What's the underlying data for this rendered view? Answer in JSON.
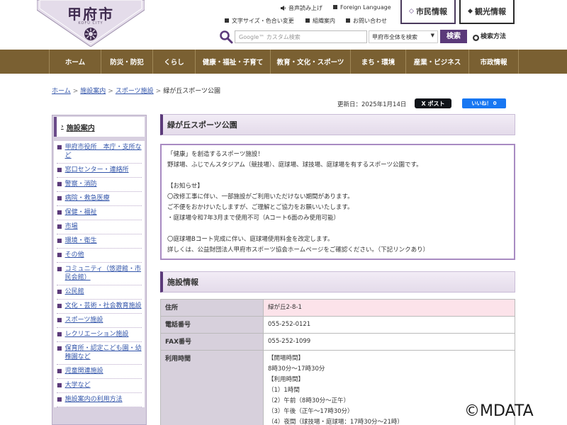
{
  "header": {
    "logo_title": "甲府市",
    "logo_sub": "KOFU CITY",
    "links": {
      "audio": "音声読み上げ",
      "foreign": "Foreign Language",
      "font_color": "文字サイズ・色合い変更",
      "org": "組織案内",
      "contact": "お問い合わせ"
    },
    "tab_shimin": "市民情報",
    "tab_kanko": "観光情報",
    "search_placeholder": "Google™ カスタム検索",
    "search_scope": "甲府市全体を検索",
    "search_button": "検索",
    "search_help": "検索方法"
  },
  "gnav": {
    "items": [
      "ホーム",
      "防災・防犯",
      "くらし",
      "健康・福祉・子育て",
      "教育・文化・スポーツ",
      "まち・環境",
      "産業・ビジネス",
      "市政情報"
    ]
  },
  "breadcrumb": {
    "home": "ホーム",
    "facility": "施設案内",
    "sports": "スポーツ施設",
    "current": "緑が丘スポーツ公園",
    "sep": ">"
  },
  "meta": {
    "updated": "更新日：2025年1月14日",
    "x_post": "X ポスト",
    "fb_like": "いいね！ 0"
  },
  "sidebar": {
    "title": "施設案内",
    "items": [
      "甲府市役所　本庁・支所など",
      "窓口センター・連絡所",
      "警察・消防",
      "病院・救急医療",
      "保健・福祉",
      "市場",
      "環境・衛生",
      "その他",
      "コミュニティ（悠遊館・市民会館）",
      "公民館",
      "文化・芸術・社会教育施設",
      "スポーツ施設",
      "レクリエーション施設",
      "保育所・認定こども園・幼稚園など",
      "児童関連施設",
      "大学など",
      "施設案内の利用方法"
    ]
  },
  "main": {
    "title": "緑が丘スポーツ公園",
    "notice": [
      "「健康」を創造するスポーツ施設！",
      "野球場、ふじでんスタジアム（競技場）、庭球場、球技場、庭球場を有するスポーツ公園です。",
      "",
      "【お知らせ】",
      "〇改修工事に伴い、一部施設がご利用いただけない期間があります。",
      "ご不便をおかけいたしますが、ご理解とご協力をお願いいたします。",
      "・庭球場令和7年3月まで使用不可（Aコート6面のみ使用可能）",
      "",
      "〇庭球場Bコート完成に伴い、庭球場使用料金を改定します。",
      "詳しくは、公益財団法人甲府市スポーツ協会ホームページをご確認ください。（下記リンクあり）"
    ],
    "facility_heading": "施設情報",
    "table": {
      "address_label": "住所",
      "address_value": "緑が丘2-8-1",
      "phone_label": "電話番号",
      "phone_value": "055-252-0121",
      "fax_label": "FAX番号",
      "fax_value": "055-252-1099",
      "hours_label": "利用時間",
      "hours_lines": [
        "【開場時間】",
        "8時30分～17時30分",
        "【利用時間】",
        "（1）1時間",
        "（2）午前（8時30分～正午）",
        "（3）午後（正午～17時30分）",
        "（4）夜間（球技場・庭球場：17時30分～21時）"
      ]
    }
  },
  "watermark": "©MDATA",
  "colors": {
    "brand_purple": "#5b3a7a",
    "nav_brown": "#7a6032",
    "sidebar_bg": "#d8d0e0",
    "table_header_bg": "#d7d0dc",
    "pink_cell": "#fce3ea"
  }
}
